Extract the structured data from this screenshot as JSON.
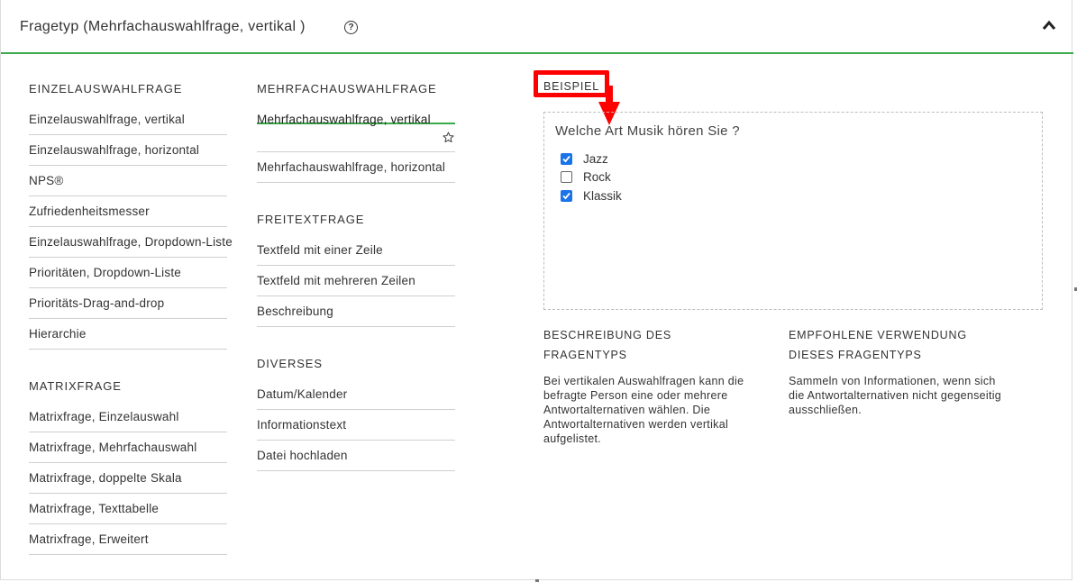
{
  "header": {
    "title": "Fragetyp (Mehrfachauswahlfrage, vertikal )",
    "help_icon": "question-circle-icon",
    "collapse_icon": "chevron-up-icon"
  },
  "col1": {
    "sections": [
      {
        "heading": "EINZELAUSWAHLFRAGE",
        "items": [
          "Einzelauswahlfrage, vertikal",
          "Einzelauswahlfrage, horizontal",
          "NPS®",
          "Zufriedenheitsmesser",
          "Einzelauswahlfrage, Dropdown-Liste",
          "Prioritäten, Dropdown-Liste",
          "Prioritäts-Drag-and-drop",
          "Hierarchie"
        ]
      },
      {
        "heading": "MATRIXFRAGE",
        "items": [
          "Matrixfrage, Einzelauswahl",
          "Matrixfrage, Mehrfachauswahl",
          "Matrixfrage, doppelte Skala",
          "Matrixfrage, Texttabelle",
          "Matrixfrage, Erweitert"
        ]
      }
    ]
  },
  "col2": {
    "sections": [
      {
        "heading": "MEHRFACHAUSWAHLFRAGE",
        "items": [
          "Mehrfachauswahlfrage, vertikal",
          "Mehrfachauswahlfrage, horizontal"
        ]
      },
      {
        "heading": "FREITEXTFRAGE",
        "items": [
          "Textfeld mit einer Zeile",
          "Textfeld mit mehreren Zeilen",
          "Beschreibung"
        ]
      },
      {
        "heading": "DIVERSES",
        "items": [
          "Datum/Kalender",
          "Informationstext",
          "Datei hochladen"
        ]
      }
    ],
    "favorite_icon": "star-outline-icon"
  },
  "example": {
    "label": "BEISPIEL",
    "question": "Welche Art Musik hören Sie ?",
    "options": [
      {
        "label": "Jazz",
        "checked": true
      },
      {
        "label": "Rock",
        "checked": false
      },
      {
        "label": "Klassik",
        "checked": true
      }
    ]
  },
  "description": {
    "heading_line1": "BESCHREIBUNG DES",
    "heading_line2": "FRAGENTYPS",
    "text": "Bei vertikalen Auswahlfragen kann die befragte Person eine oder mehrere Antwortalternativen wählen. Die Antwortalternativen werden vertikal aufgelistet."
  },
  "usage": {
    "heading_line1": "EMPFOHLENE VERWENDUNG",
    "heading_line2": "DIESES FRAGENTYPS",
    "text": "Sammeln von Informationen, wenn sich die Antwortalternativen nicht gegenseitig ausschließen."
  },
  "colors": {
    "accent_green": "#3aaa4a",
    "annotation_red": "#ff0000",
    "checkbox_blue": "#1a73e8"
  }
}
